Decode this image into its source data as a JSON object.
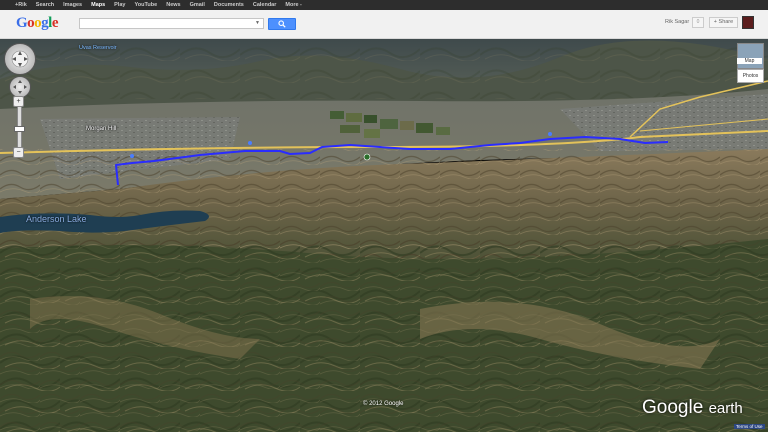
{
  "topnav": {
    "items": [
      "+Rik",
      "Search",
      "Images",
      "Maps",
      "Play",
      "YouTube",
      "News",
      "Gmail",
      "Documents",
      "Calendar",
      "More -"
    ],
    "active": "Maps"
  },
  "header": {
    "logo_letters": [
      "G",
      "o",
      "o",
      "g",
      "l",
      "e"
    ],
    "search_placeholder": "",
    "user_name": "Rik Sagar",
    "notification_count": "0",
    "share_label": "+ Share"
  },
  "map": {
    "labels": {
      "reservoir": "Uvas Reservoir",
      "town": "Morgan Hill",
      "lake": "Anderson Lake"
    },
    "copyright": "© 2012 Google",
    "brand_main": "Google",
    "brand_sub": "earth",
    "terms": "Terms of Use",
    "controls": {
      "map_toggle_label": "Map",
      "photos_label": "Photos",
      "zoom_in": "+",
      "zoom_out": "−"
    },
    "route_color": "#2a2cff",
    "road_color": "#e3c25a"
  }
}
